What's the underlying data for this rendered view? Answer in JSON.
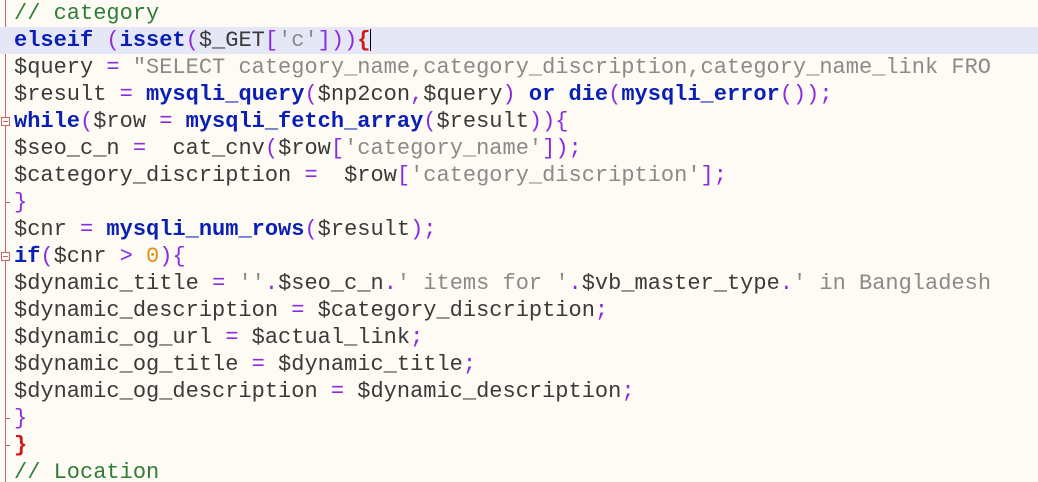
{
  "editor": {
    "colors": {
      "background": "#fdfbf3",
      "current_line": "#e6e7f6",
      "comment": "#2f7d39",
      "keyword": "#0a1fb4",
      "variable": "#3a3a3a",
      "operator": "#8a2be2",
      "string": "#8a8a8a",
      "number": "#e0901a",
      "brace_match": "#d01818",
      "fold_marker": "#c8656a"
    },
    "lines": [
      {
        "id": "l1",
        "tokens": [
          {
            "t": "comment",
            "v": "// category"
          }
        ]
      },
      {
        "id": "l2",
        "current": true,
        "tokens": [
          {
            "t": "kw",
            "v": "elseif"
          },
          {
            "t": "plain",
            "v": " "
          },
          {
            "t": "op",
            "v": "("
          },
          {
            "t": "fn",
            "v": "isset"
          },
          {
            "t": "op",
            "v": "("
          },
          {
            "t": "var",
            "v": "$_GET"
          },
          {
            "t": "op",
            "v": "["
          },
          {
            "t": "str",
            "v": "'c'"
          },
          {
            "t": "op",
            "v": "]))"
          },
          {
            "t": "brace-red",
            "v": "{"
          }
        ]
      },
      {
        "id": "l3",
        "tokens": [
          {
            "t": "var",
            "v": "$query"
          },
          {
            "t": "plain",
            "v": " "
          },
          {
            "t": "op",
            "v": "="
          },
          {
            "t": "plain",
            "v": " "
          },
          {
            "t": "str",
            "v": "\"SELECT category_name,category_discription,category_name_link FRO"
          }
        ]
      },
      {
        "id": "l4",
        "tokens": [
          {
            "t": "var",
            "v": "$result"
          },
          {
            "t": "plain",
            "v": " "
          },
          {
            "t": "op",
            "v": "="
          },
          {
            "t": "plain",
            "v": " "
          },
          {
            "t": "fn",
            "v": "mysqli_query"
          },
          {
            "t": "op",
            "v": "("
          },
          {
            "t": "var",
            "v": "$np2con"
          },
          {
            "t": "op",
            "v": ","
          },
          {
            "t": "var",
            "v": "$query"
          },
          {
            "t": "op",
            "v": ")"
          },
          {
            "t": "plain",
            "v": " "
          },
          {
            "t": "kw",
            "v": "or"
          },
          {
            "t": "plain",
            "v": " "
          },
          {
            "t": "fn",
            "v": "die"
          },
          {
            "t": "op",
            "v": "("
          },
          {
            "t": "fn",
            "v": "mysqli_error"
          },
          {
            "t": "op",
            "v": "());"
          }
        ]
      },
      {
        "id": "l5",
        "tokens": [
          {
            "t": "kw",
            "v": "while"
          },
          {
            "t": "op",
            "v": "("
          },
          {
            "t": "var",
            "v": "$row"
          },
          {
            "t": "plain",
            "v": " "
          },
          {
            "t": "op",
            "v": "="
          },
          {
            "t": "plain",
            "v": " "
          },
          {
            "t": "fn",
            "v": "mysqli_fetch_array"
          },
          {
            "t": "op",
            "v": "("
          },
          {
            "t": "var",
            "v": "$result"
          },
          {
            "t": "op",
            "v": ")){"
          }
        ]
      },
      {
        "id": "l6",
        "tokens": [
          {
            "t": "var",
            "v": "$seo_c_n"
          },
          {
            "t": "plain",
            "v": " "
          },
          {
            "t": "op",
            "v": "="
          },
          {
            "t": "plain",
            "v": "  "
          },
          {
            "t": "plain",
            "v": "cat_cnv"
          },
          {
            "t": "op",
            "v": "("
          },
          {
            "t": "var",
            "v": "$row"
          },
          {
            "t": "op",
            "v": "["
          },
          {
            "t": "str",
            "v": "'category_name'"
          },
          {
            "t": "op",
            "v": "]);"
          }
        ]
      },
      {
        "id": "l7",
        "tokens": [
          {
            "t": "var",
            "v": "$category_discription"
          },
          {
            "t": "plain",
            "v": " "
          },
          {
            "t": "op",
            "v": "="
          },
          {
            "t": "plain",
            "v": "  "
          },
          {
            "t": "var",
            "v": "$row"
          },
          {
            "t": "op",
            "v": "["
          },
          {
            "t": "str",
            "v": "'category_discription'"
          },
          {
            "t": "op",
            "v": "];"
          }
        ]
      },
      {
        "id": "l8",
        "tokens": [
          {
            "t": "op",
            "v": "}"
          }
        ]
      },
      {
        "id": "l9",
        "tokens": [
          {
            "t": "var",
            "v": "$cnr"
          },
          {
            "t": "plain",
            "v": " "
          },
          {
            "t": "op",
            "v": "="
          },
          {
            "t": "plain",
            "v": " "
          },
          {
            "t": "fn",
            "v": "mysqli_num_rows"
          },
          {
            "t": "op",
            "v": "("
          },
          {
            "t": "var",
            "v": "$result"
          },
          {
            "t": "op",
            "v": ");"
          }
        ]
      },
      {
        "id": "l10",
        "tokens": [
          {
            "t": "kw",
            "v": "if"
          },
          {
            "t": "op",
            "v": "("
          },
          {
            "t": "var",
            "v": "$cnr"
          },
          {
            "t": "plain",
            "v": " "
          },
          {
            "t": "op",
            "v": ">"
          },
          {
            "t": "plain",
            "v": " "
          },
          {
            "t": "num",
            "v": "0"
          },
          {
            "t": "op",
            "v": "){"
          }
        ]
      },
      {
        "id": "l11",
        "tokens": [
          {
            "t": "var",
            "v": "$dynamic_title"
          },
          {
            "t": "plain",
            "v": " "
          },
          {
            "t": "op",
            "v": "="
          },
          {
            "t": "plain",
            "v": " "
          },
          {
            "t": "str",
            "v": "''"
          },
          {
            "t": "op",
            "v": "."
          },
          {
            "t": "var",
            "v": "$seo_c_n"
          },
          {
            "t": "op",
            "v": "."
          },
          {
            "t": "str",
            "v": "' items for '"
          },
          {
            "t": "op",
            "v": "."
          },
          {
            "t": "var",
            "v": "$vb_master_type"
          },
          {
            "t": "op",
            "v": "."
          },
          {
            "t": "str",
            "v": "' in Bangladesh"
          }
        ]
      },
      {
        "id": "l12",
        "tokens": [
          {
            "t": "var",
            "v": "$dynamic_description"
          },
          {
            "t": "plain",
            "v": " "
          },
          {
            "t": "op",
            "v": "="
          },
          {
            "t": "plain",
            "v": " "
          },
          {
            "t": "var",
            "v": "$category_discription"
          },
          {
            "t": "op",
            "v": ";"
          }
        ]
      },
      {
        "id": "l13",
        "tokens": [
          {
            "t": "var",
            "v": "$dynamic_og_url"
          },
          {
            "t": "plain",
            "v": " "
          },
          {
            "t": "op",
            "v": "="
          },
          {
            "t": "plain",
            "v": " "
          },
          {
            "t": "var",
            "v": "$actual_link"
          },
          {
            "t": "op",
            "v": ";"
          }
        ]
      },
      {
        "id": "l14",
        "tokens": [
          {
            "t": "var",
            "v": "$dynamic_og_title"
          },
          {
            "t": "plain",
            "v": " "
          },
          {
            "t": "op",
            "v": "="
          },
          {
            "t": "plain",
            "v": " "
          },
          {
            "t": "var",
            "v": "$dynamic_title"
          },
          {
            "t": "op",
            "v": ";"
          }
        ]
      },
      {
        "id": "l15",
        "tokens": [
          {
            "t": "var",
            "v": "$dynamic_og_description"
          },
          {
            "t": "plain",
            "v": " "
          },
          {
            "t": "op",
            "v": "="
          },
          {
            "t": "plain",
            "v": " "
          },
          {
            "t": "var",
            "v": "$dynamic_description"
          },
          {
            "t": "op",
            "v": ";"
          }
        ]
      },
      {
        "id": "l16",
        "tokens": [
          {
            "t": "op",
            "v": "}"
          }
        ]
      },
      {
        "id": "l17",
        "tokens": [
          {
            "t": "brace-red",
            "v": "}"
          }
        ]
      },
      {
        "id": "l18",
        "tokens": [
          {
            "t": "comment",
            "v": "// Location"
          }
        ]
      }
    ]
  }
}
